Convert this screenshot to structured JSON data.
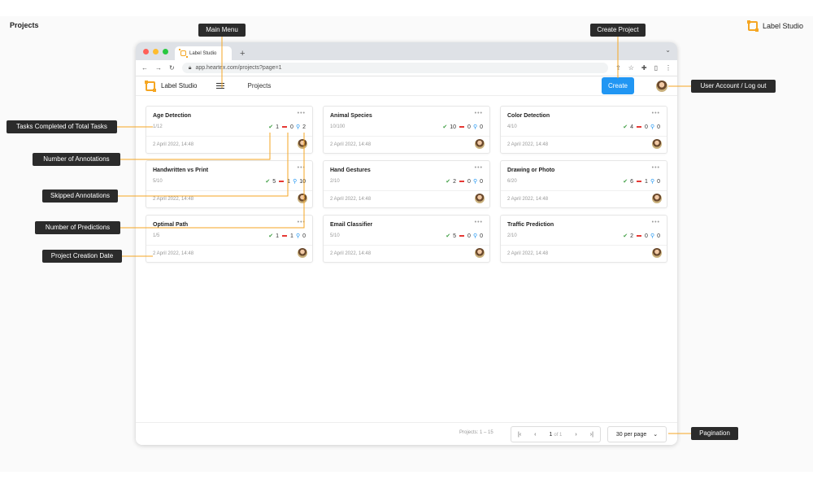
{
  "page": {
    "title": "Projects",
    "brand": "Label Studio"
  },
  "browser": {
    "tab_title": "Label Studio",
    "new_tab": "+",
    "url": "app.heartex.com/projects?page=1"
  },
  "app": {
    "brand": "Label Studio",
    "breadcrumb": "Projects",
    "create_label": "Create"
  },
  "projects": [
    {
      "title": "Age Detection",
      "progress": "1/12",
      "completed": "1",
      "skipped": "0",
      "predictions": "2",
      "date": "2 April 2022, 14:48"
    },
    {
      "title": "Animal Species",
      "progress": "10/100",
      "completed": "10",
      "skipped": "0",
      "predictions": "0",
      "date": "2 April 2022, 14:48"
    },
    {
      "title": "Color Detection",
      "progress": "4/10",
      "completed": "4",
      "skipped": "0",
      "predictions": "0",
      "date": "2 April 2022, 14:48"
    },
    {
      "title": "Handwritten vs Print",
      "progress": "5/10",
      "completed": "5",
      "skipped": "1",
      "predictions": "10",
      "date": "2 April 2022, 14:48"
    },
    {
      "title": "Hand Gestures",
      "progress": "2/10",
      "completed": "2",
      "skipped": "0",
      "predictions": "0",
      "date": "2 April 2022, 14:48"
    },
    {
      "title": "Drawing or Photo",
      "progress": "6/20",
      "completed": "6",
      "skipped": "1",
      "predictions": "0",
      "date": "2 April 2022, 14:48"
    },
    {
      "title": "Optimal Path",
      "progress": "1/5",
      "completed": "1",
      "skipped": "1",
      "predictions": "0",
      "date": "2 April 2022, 14:48"
    },
    {
      "title": "Email Classifier",
      "progress": "5/10",
      "completed": "5",
      "skipped": "0",
      "predictions": "0",
      "date": "2 April 2022, 14:48"
    },
    {
      "title": "Traffic Prediction",
      "progress": "2/10",
      "completed": "2",
      "skipped": "0",
      "predictions": "0",
      "date": "2 April 2022, 14:48"
    }
  ],
  "footer": {
    "summary": "Projects: 1 – 15",
    "page": "1",
    "of": "of 1",
    "per_page": "30 per page"
  },
  "callouts": {
    "main_menu": "Main Menu",
    "create_project": "Create Project",
    "user_account": "User Account / Log out",
    "tasks_completed": "Tasks Completed of Total Tasks",
    "num_annotations": "Number of Annotations",
    "skipped": "Skipped Annotations",
    "num_predictions": "Number of Predictions",
    "creation_date": "Project Creation Date",
    "pagination": "Pagination"
  },
  "colors": {
    "accent": "#2196f3",
    "brand": "#f5a623",
    "callout_bg": "#2b2b2b",
    "callout_line": "#f5a623",
    "completed": "#43a047",
    "skipped": "#e53935"
  },
  "icons": [
    "label-studio-logo-icon",
    "hamburger-menu-icon",
    "check-icon",
    "skip-dash-icon",
    "prediction-bulb-icon",
    "more-dots-icon",
    "avatar"
  ]
}
